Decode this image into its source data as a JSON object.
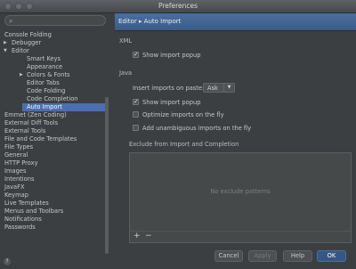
{
  "window": {
    "title": "Preferences"
  },
  "search": {
    "placeholder": ""
  },
  "sidebar": {
    "items": [
      {
        "label": "Console Folding"
      },
      {
        "label": "Debugger"
      },
      {
        "label": "Editor"
      },
      {
        "label": "Smart Keys"
      },
      {
        "label": "Appearance"
      },
      {
        "label": "Colors & Fonts"
      },
      {
        "label": "Editor Tabs"
      },
      {
        "label": "Code Folding"
      },
      {
        "label": "Code Completion"
      },
      {
        "label": "Auto Import"
      },
      {
        "label": "Emmet (Zen Coding)"
      },
      {
        "label": "External Diff Tools"
      },
      {
        "label": "External Tools"
      },
      {
        "label": "File and Code Templates"
      },
      {
        "label": "File Types"
      },
      {
        "label": "General"
      },
      {
        "label": "HTTP Proxy"
      },
      {
        "label": "Images"
      },
      {
        "label": "Intentions"
      },
      {
        "label": "JavaFX"
      },
      {
        "label": "Keymap"
      },
      {
        "label": "Live Templates"
      },
      {
        "label": "Menus and Toolbars"
      },
      {
        "label": "Notifications"
      },
      {
        "label": "Passwords"
      }
    ],
    "selected": "Auto Import"
  },
  "breadcrumb": {
    "text": "Editor ▸ Auto Import"
  },
  "xml": {
    "title": "XML",
    "show_import_popup": {
      "label": "Show import popup",
      "checked": true
    }
  },
  "java": {
    "title": "Java",
    "insert_on_paste": {
      "label": "Insert imports on paste:",
      "value": "Ask"
    },
    "show_import_popup": {
      "label": "Show import popup",
      "checked": true
    },
    "optimize_on_fly": {
      "label": "Optimize imports on the fly",
      "checked": false
    },
    "add_unambiguous": {
      "label": "Add unambiguous imports on the fly",
      "checked": false
    }
  },
  "exclude": {
    "title": "Exclude from Import and Completion",
    "empty_text": "No exclude patterns",
    "add_symbol": "+",
    "remove_symbol": "−"
  },
  "buttons": {
    "cancel": "Cancel",
    "apply": "Apply",
    "help": "Help",
    "ok": "OK"
  },
  "colors": {
    "accent": "#4b6eaf",
    "background": "#3c3f41"
  }
}
